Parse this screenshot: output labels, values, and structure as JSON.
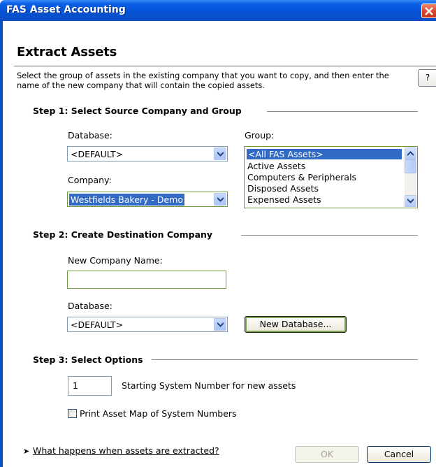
{
  "window": {
    "title": "FAS Asset Accounting"
  },
  "heading": "Extract Assets",
  "intro": "Select the group of assets in the existing company that you want to copy, and then enter the name of the new company that will contain the copied assets.",
  "help_label": "?",
  "step1": {
    "title": "Step 1: Select Source Company and Group",
    "database_label": "Database:",
    "database_value": "<DEFAULT>",
    "company_label": "Company:",
    "company_value": "Westfields Bakery - Demo",
    "group_label": "Group:",
    "group_items": [
      "<All FAS Assets>",
      "Active Assets",
      "Computers & Peripherals",
      "Disposed Assets",
      "Expensed Assets"
    ]
  },
  "step2": {
    "title": "Step 2: Create Destination Company",
    "new_company_label": "New Company Name:",
    "new_company_value": "",
    "database_label": "Database:",
    "database_value": "<DEFAULT>",
    "new_database_button": "New Database..."
  },
  "step3": {
    "title": "Step 3: Select Options",
    "start_number_value": "1",
    "start_number_label": "Starting System Number for new assets",
    "print_map_label": "Print Asset Map of System Numbers",
    "print_map_checked": false
  },
  "footer": {
    "link_text": "What happens when assets are extracted?",
    "ok_label": "OK",
    "cancel_label": "Cancel"
  },
  "colors": {
    "title_bar": "#0452d4",
    "selection": "#316ac5",
    "focus_green": "#6c9a3c"
  }
}
